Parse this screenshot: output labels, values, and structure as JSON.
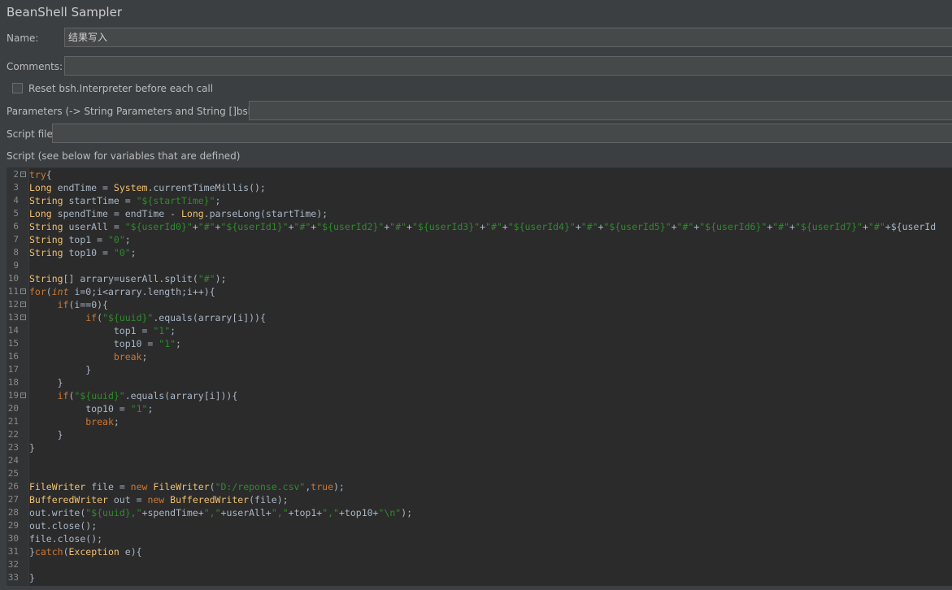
{
  "panel": {
    "title": "BeanShell Sampler",
    "name_label": "Name:",
    "name_value": "结果写入",
    "comments_label": "Comments:",
    "comments_value": "",
    "reset_label": "Reset bsh.Interpreter before each call",
    "reset_checked": false,
    "parameters_label": "Parameters (-> String Parameters and String []bsh.args)",
    "parameters_value": "",
    "script_file_label": "Script file",
    "script_file_value": "",
    "script_label": "Script (see below for variables that are defined)"
  },
  "editor": {
    "lines": [
      {
        "n": "2",
        "fold": true,
        "text": "try{"
      },
      {
        "n": "3",
        "fold": false,
        "text": "Long endTime = System.currentTimeMillis();"
      },
      {
        "n": "4",
        "fold": false,
        "text": "String startTime = \"${startTime}\";"
      },
      {
        "n": "5",
        "fold": false,
        "text": "Long spendTime = endTime - Long.parseLong(startTime);"
      },
      {
        "n": "6",
        "fold": false,
        "text": "String userAll = \"${userId0}\"+\"#\"+\"${userId1}\"+\"#\"+\"${userId2}\"+\"#\"+\"${userId3}\"+\"#\"+\"${userId4}\"+\"#\"+\"${userId5}\"+\"#\"+\"${userId6}\"+\"#\"+\"${userId7}\"+\"#\"+\"${userId"
      },
      {
        "n": "7",
        "fold": false,
        "text": "String top1 = \"0\";"
      },
      {
        "n": "8",
        "fold": false,
        "text": "String top10 = \"0\";"
      },
      {
        "n": "9",
        "fold": false,
        "text": ""
      },
      {
        "n": "10",
        "fold": false,
        "text": "String[] arrary=userAll.split(\"#\");"
      },
      {
        "n": "11",
        "fold": true,
        "text": "for(int i=0;i<arrary.length;i++){"
      },
      {
        "n": "12",
        "fold": true,
        "text": "     if(i==0){"
      },
      {
        "n": "13",
        "fold": true,
        "text": "          if(\"${uuid}\".equals(arrary[i])){"
      },
      {
        "n": "14",
        "fold": false,
        "text": "               top1 = \"1\";"
      },
      {
        "n": "15",
        "fold": false,
        "text": "               top10 = \"1\";"
      },
      {
        "n": "16",
        "fold": false,
        "text": "               break;"
      },
      {
        "n": "17",
        "fold": false,
        "text": "          }"
      },
      {
        "n": "18",
        "fold": false,
        "text": "     }"
      },
      {
        "n": "19",
        "fold": true,
        "text": "     if(\"${uuid}\".equals(arrary[i])){"
      },
      {
        "n": "20",
        "fold": false,
        "text": "          top10 = \"1\";"
      },
      {
        "n": "21",
        "fold": false,
        "text": "          break;"
      },
      {
        "n": "22",
        "fold": false,
        "text": "     }"
      },
      {
        "n": "23",
        "fold": false,
        "text": "}"
      },
      {
        "n": "24",
        "fold": false,
        "text": ""
      },
      {
        "n": "25",
        "fold": false,
        "text": ""
      },
      {
        "n": "26",
        "fold": false,
        "text": "FileWriter file = new FileWriter(\"D:/reponse.csv\",true);"
      },
      {
        "n": "27",
        "fold": false,
        "text": "BufferedWriter out = new BufferedWriter(file);"
      },
      {
        "n": "28",
        "fold": false,
        "text": "out.write(\"${uuid},\"+spendTime+\",\"+userAll+\",\"+top1+\",\"+top10+\"\\n\");"
      },
      {
        "n": "29",
        "fold": false,
        "text": "out.close();"
      },
      {
        "n": "30",
        "fold": false,
        "text": "file.close();"
      },
      {
        "n": "31",
        "fold": false,
        "text": "}catch(Exception e){"
      },
      {
        "n": "32",
        "fold": false,
        "text": ""
      },
      {
        "n": "33",
        "fold": false,
        "text": "}"
      }
    ]
  },
  "colors": {
    "background": "#3c3f41",
    "editor_background": "#2b2b2b",
    "keyword": "#cc7832",
    "string": "#2e8b2e",
    "type": "#f0c070"
  }
}
